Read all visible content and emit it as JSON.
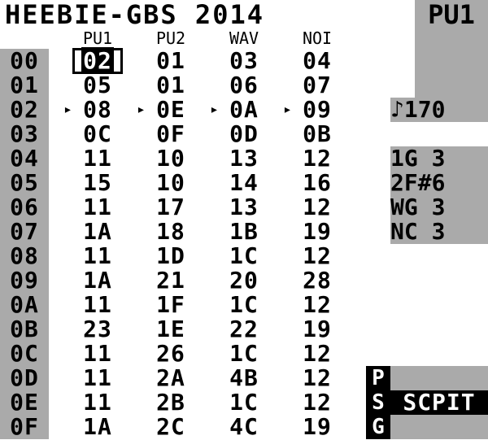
{
  "header": {
    "title": "HEEBIE-GBS 2014",
    "view": "PU1"
  },
  "channels": [
    "PU1",
    "PU2",
    "WAV",
    "NOI"
  ],
  "rows": [
    {
      "n": "00",
      "c": [
        "02",
        "01",
        "03",
        "04"
      ]
    },
    {
      "n": "01",
      "c": [
        "05",
        "01",
        "06",
        "07"
      ]
    },
    {
      "n": "02",
      "c": [
        "08",
        "0E",
        "0A",
        "09"
      ]
    },
    {
      "n": "03",
      "c": [
        "0C",
        "0F",
        "0D",
        "0B"
      ]
    },
    {
      "n": "04",
      "c": [
        "11",
        "10",
        "13",
        "12"
      ]
    },
    {
      "n": "05",
      "c": [
        "15",
        "10",
        "14",
        "16"
      ]
    },
    {
      "n": "06",
      "c": [
        "11",
        "17",
        "13",
        "12"
      ]
    },
    {
      "n": "07",
      "c": [
        "1A",
        "18",
        "1B",
        "19"
      ]
    },
    {
      "n": "08",
      "c": [
        "11",
        "1D",
        "1C",
        "12"
      ]
    },
    {
      "n": "09",
      "c": [
        "1A",
        "21",
        "20",
        "28"
      ]
    },
    {
      "n": "0A",
      "c": [
        "11",
        "1F",
        "1C",
        "12"
      ]
    },
    {
      "n": "0B",
      "c": [
        "23",
        "1E",
        "22",
        "19"
      ]
    },
    {
      "n": "0C",
      "c": [
        "11",
        "26",
        "1C",
        "12"
      ]
    },
    {
      "n": "0D",
      "c": [
        "11",
        "2A",
        "4B",
        "12"
      ]
    },
    {
      "n": "0E",
      "c": [
        "11",
        "2B",
        "1C",
        "12"
      ]
    },
    {
      "n": "0F",
      "c": [
        "1A",
        "2C",
        "4C",
        "19"
      ]
    }
  ],
  "cursor": {
    "row": 0,
    "channel": 0
  },
  "play_row": 2,
  "tempo": "♪170",
  "status": [
    {
      "label": "1G 3"
    },
    {
      "label": "2F#6"
    },
    {
      "label": "WG 3"
    },
    {
      "label": "NC 3"
    }
  ],
  "screens": [
    "P",
    "S",
    "G"
  ],
  "mode": "SCPIT",
  "colors": {
    "bg": "#ffffff",
    "panel": "#aaaaaa",
    "fg": "#000000"
  }
}
